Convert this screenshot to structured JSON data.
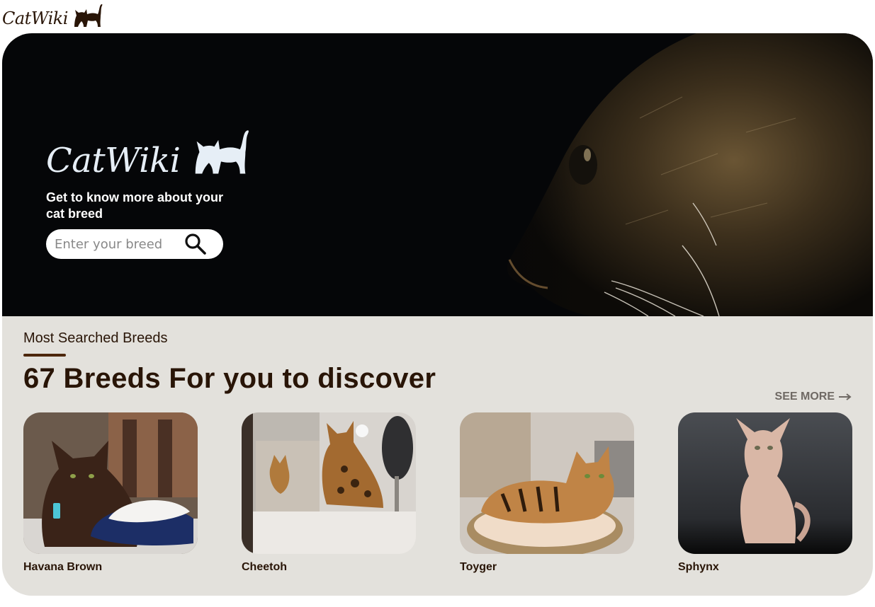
{
  "brand": {
    "name": "CatWiki",
    "logo_icon": "cat-silhouette-icon"
  },
  "hero": {
    "logo_text": "CatWiki",
    "tagline": "Get to know more about your cat breed",
    "search": {
      "placeholder": "Enter your breed",
      "value": "",
      "icon": "search-icon"
    }
  },
  "section": {
    "label": "Most Searched Breeds",
    "title": "67 Breeds For you to discover",
    "see_more": "SEE MORE",
    "see_more_icon": "arrow-right-icon"
  },
  "breeds": [
    {
      "name": "Havana Brown"
    },
    {
      "name": "Cheetoh"
    },
    {
      "name": "Toyger"
    },
    {
      "name": "Sphynx"
    }
  ],
  "colors": {
    "text_dark": "#291507",
    "hero_bg": "#050608",
    "section_bg": "#e3e1dc",
    "accent": "#4d270c"
  }
}
